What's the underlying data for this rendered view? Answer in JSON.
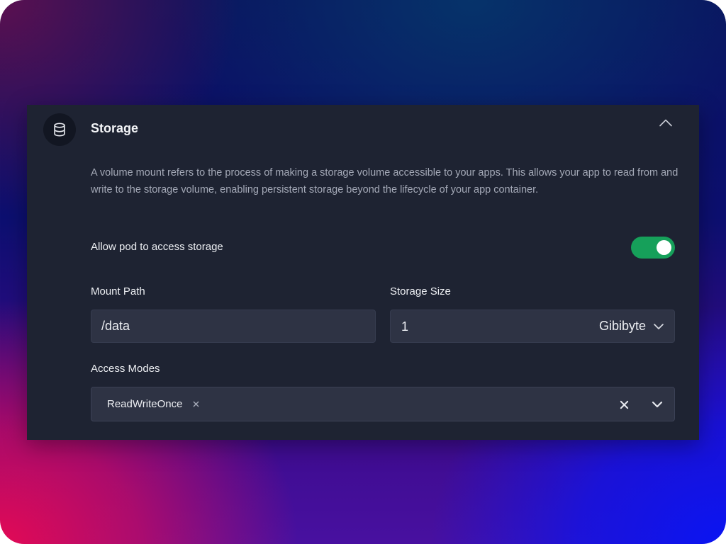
{
  "section": {
    "title": "Storage",
    "icon": "database-icon",
    "collapse_icon": "chevron-up-icon",
    "description": "A volume mount refers to the process of making a storage volume accessible to your apps. This allows your app to read from and write to the storage volume, enabling persistent storage beyond the lifecycle of your app container."
  },
  "allow_access": {
    "label": "Allow pod to access storage",
    "enabled": true,
    "toggle_color": "#16a05a"
  },
  "mount_path": {
    "label": "Mount Path",
    "value": "/data"
  },
  "storage_size": {
    "label": "Storage Size",
    "value": "1",
    "unit": "Gibibyte",
    "unit_icon": "chevron-down-icon"
  },
  "access_modes": {
    "label": "Access Modes",
    "selected": [
      "ReadWriteOnce"
    ],
    "chip_remove_icon": "close-icon",
    "clear_icon": "close-icon",
    "dropdown_icon": "chevron-down-icon"
  },
  "colors": {
    "card_background": "#1e2332",
    "input_background": "#2e3344",
    "text_primary": "#eceef2",
    "text_secondary": "#a4a9b7"
  }
}
